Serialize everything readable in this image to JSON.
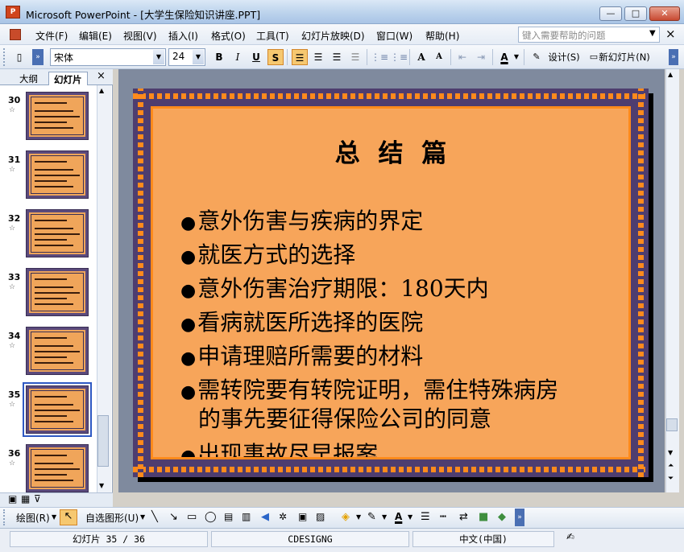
{
  "window": {
    "title": "Microsoft PowerPoint - [大学生保险知识讲座.PPT]",
    "icon_text": "P",
    "minimize": "—",
    "maximize": "□",
    "close": "✕"
  },
  "menu": {
    "items": [
      "文件(F)",
      "编辑(E)",
      "视图(V)",
      "插入(I)",
      "格式(O)",
      "工具(T)",
      "幻灯片放映(D)",
      "窗口(W)",
      "帮助(H)"
    ],
    "help_placeholder": "键入需要帮助的问题",
    "close_doc": "×"
  },
  "toolbar": {
    "font_name": "宋体",
    "font_size": "24",
    "bold": "B",
    "italic": "I",
    "underline": "U",
    "shadow": "S",
    "grow_font": "A",
    "shrink_font": "A",
    "font_color": "A",
    "design_label": "设计(S)",
    "new_slide_label": "新幻灯片(N)"
  },
  "left_pane": {
    "tabs": [
      "大纲",
      "幻灯片"
    ],
    "close": "×",
    "thumbnails": [
      {
        "num": "30"
      },
      {
        "num": "31"
      },
      {
        "num": "32"
      },
      {
        "num": "33"
      },
      {
        "num": "34"
      },
      {
        "num": "35"
      },
      {
        "num": "36"
      }
    ],
    "selected": "35"
  },
  "slide": {
    "title": "总 结 篇",
    "bullets": [
      "意外伤害与疾病的界定",
      "就医方式的选择",
      "意外伤害治疗期限：180天内",
      "看病就医所选择的医院",
      "申请理赔所需要的材料",
      "需转院要有转院证明，需住特殊病房",
      "的事先要征得保险公司的同意",
      "出现事故尽早报案"
    ],
    "bullet_char": "●",
    "colors": {
      "frame": "#4e3d6f",
      "accent": "#ff8a1c",
      "background": "#f7a55a"
    }
  },
  "draw_toolbar": {
    "draw_label": "绘图(R)",
    "autoshape_label": "自选图形(U)"
  },
  "status": {
    "slide_index": "幻灯片 35 / 36",
    "design": "CDESIGNG",
    "language": "中文(中国)"
  }
}
